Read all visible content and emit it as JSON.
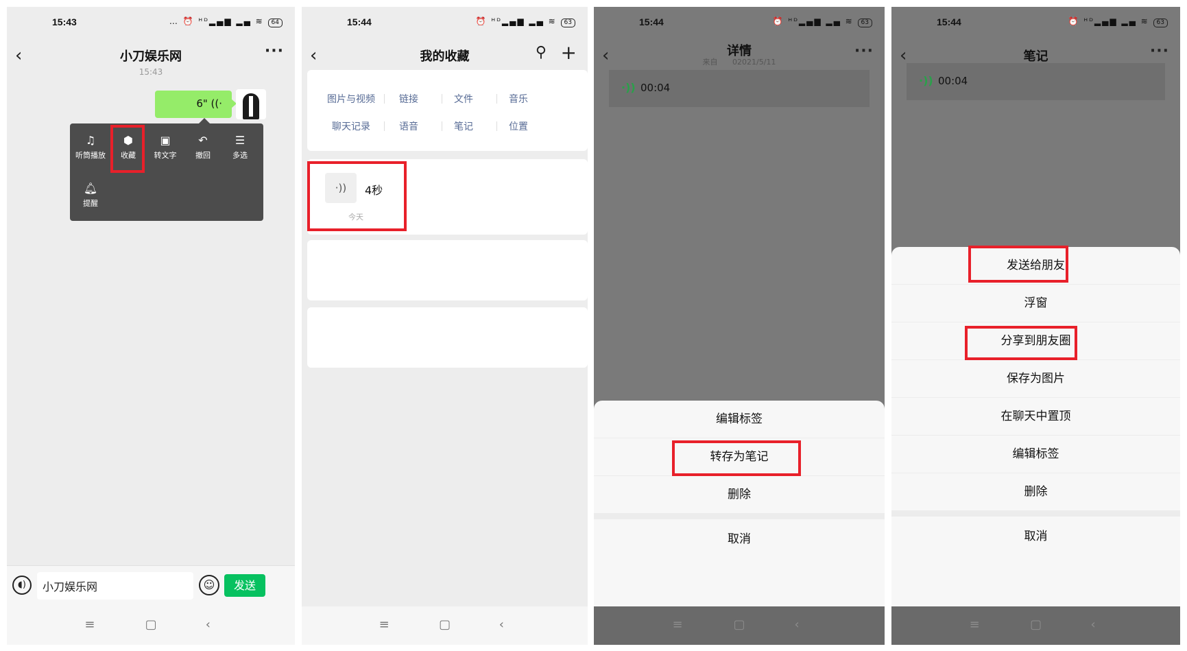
{
  "panel1": {
    "status_time": "15:43",
    "status_icons": "… ⏰ ᴴᴰ▂▄▆ ▂▄ ≋",
    "battery": "64",
    "title": "小刀娱乐网",
    "more": "···",
    "chat_time": "15:43",
    "voice_message": "6\" ((·",
    "menu_items": [
      {
        "label": "听筒播放",
        "icon": "ear-icon"
      },
      {
        "label": "收藏",
        "icon": "cube-icon"
      },
      {
        "label": "转文字",
        "icon": "translate-icon"
      },
      {
        "label": "撤回",
        "icon": "undo-icon"
      },
      {
        "label": "多选",
        "icon": "list-icon"
      },
      {
        "label": "提醒",
        "icon": "bell-icon"
      }
    ],
    "input_value": "小刀娱乐网",
    "send_label": "发送"
  },
  "panel2": {
    "status_time": "15:44",
    "status_icons": "⏰ ᴴᴰ▂▄▆ ▂▄ ≋",
    "battery": "63",
    "title": "我的收藏",
    "categories": [
      "图片与视频",
      "链接",
      "文件",
      "音乐",
      "聊天记录",
      "语音",
      "笔记",
      "位置"
    ],
    "fav_item": {
      "title": "4秒",
      "date": "今天"
    }
  },
  "panel3": {
    "status_time": "15:44",
    "status_icons": "⏰ ᴴᴰ▂▄▆ ▂▄ ≋",
    "battery": "63",
    "title": "详情",
    "subtitle_from": "来自",
    "subtitle_date": "02021/5/11",
    "voice_duration": "00:04",
    "sheet_items": [
      "编辑标签",
      "转存为笔记",
      "删除"
    ],
    "cancel_label": "取消"
  },
  "panel4": {
    "status_time": "15:44",
    "status_icons": "⏰ ᴴᴰ▂▄▆ ▂▄ ≋",
    "battery": "63",
    "title": "笔记",
    "voice_duration": "00:04",
    "sheet_items": [
      "发送给朋友",
      "浮窗",
      "分享到朋友圈",
      "保存为图片",
      "在聊天中置顶",
      "编辑标签",
      "删除"
    ],
    "cancel_label": "取消"
  },
  "sysnav": {
    "menu": "≡",
    "home": "▢",
    "back": "‹"
  },
  "colors": {
    "highlight": "#e8202a",
    "wechat_green": "#07c160",
    "bubble_green": "#95ec69",
    "link_blue": "#576b95"
  }
}
